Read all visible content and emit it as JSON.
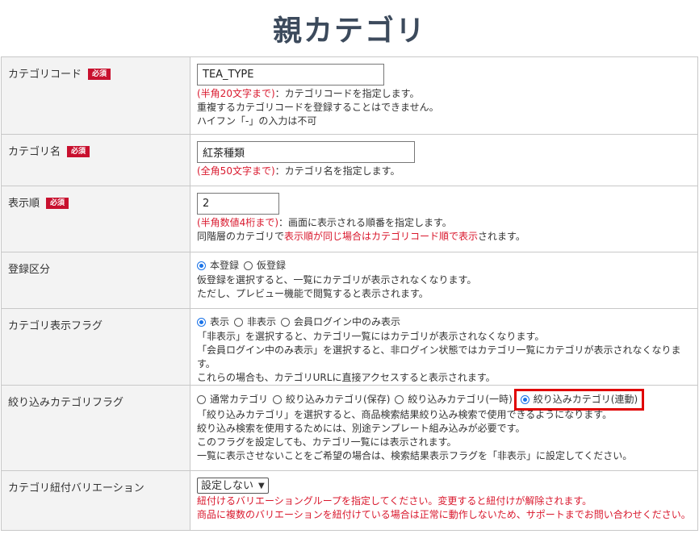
{
  "page_title": "親カテゴリ",
  "rows": {
    "code": {
      "label": "カテゴリコード",
      "required": "必須",
      "value": "TEA_TYPE",
      "limit": "(半角20文字まで)",
      "desc": "：カテゴリコードを指定します。",
      "note1": "重複するカテゴリコードを登録することはできません。",
      "note2": "ハイフン「-」の入力は不可"
    },
    "name": {
      "label": "カテゴリ名",
      "required": "必須",
      "value": "紅茶種類",
      "limit": "(全角50文字まで)",
      "desc": "：カテゴリ名を指定します。"
    },
    "order": {
      "label": "表示順",
      "required": "必須",
      "value": "2",
      "limit": "(半角数値4桁まで)",
      "desc": "：画面に表示される順番を指定します。",
      "note_a": "同階層のカテゴリで",
      "note_b": "表示順が同じ場合はカテゴリコード順で表示",
      "note_c": "されます。"
    },
    "registration": {
      "label": "登録区分",
      "options": [
        "本登録",
        "仮登録"
      ],
      "selected": "本登録",
      "note1": "仮登録を選択すると、一覧にカテゴリが表示されなくなります。",
      "note2": "ただし、プレビュー機能で閲覧すると表示されます。"
    },
    "display_flag": {
      "label": "カテゴリ表示フラグ",
      "options": [
        "表示",
        "非表示",
        "会員ログイン中のみ表示"
      ],
      "selected": "表示",
      "note1": "「非表示」を選択すると、カテゴリ一覧にはカテゴリが表示されなくなります。",
      "note2": "「会員ログイン中のみ表示」を選択すると、非ログイン状態ではカテゴリ一覧にカテゴリが表示されなくなります。",
      "note3": "これらの場合も、カテゴリURLに直接アクセスすると表示されます。"
    },
    "filter_flag": {
      "label": "絞り込みカテゴリフラグ",
      "options": [
        "通常カテゴリ",
        "絞り込みカテゴリ(保存)",
        "絞り込みカテゴリ(一時)",
        "絞り込みカテゴリ(連動)"
      ],
      "selected": "絞り込みカテゴリ(連動)",
      "note1": "「絞り込みカテゴリ」を選択すると、商品検索結果絞り込み検索で使用できるようになります。",
      "note2": "絞り込み検索を使用するためには、別途テンプレート組み込みが必要です。",
      "note3": "このフラグを設定しても、カテゴリ一覧には表示されます。",
      "note4": "一覧に表示させないことをご希望の場合は、検索結果表示フラグを「非表示」に設定してください。"
    },
    "variation": {
      "label": "カテゴリ紐付バリエーション",
      "selected": "設定しない",
      "note1": "紐付けるバリエーショングループを指定してください。変更すると紐付けが解除されます。",
      "note2": "商品に複数のバリエーションを紐付けている場合は正常に動作しないため、サポートまでお問い合わせください。"
    }
  },
  "colors": {
    "required_badge": "#c8102e",
    "note_red": "#d9182d",
    "radio_selected": "#1a73e8",
    "highlight": "#e00000",
    "title": "#3c4a5c"
  }
}
